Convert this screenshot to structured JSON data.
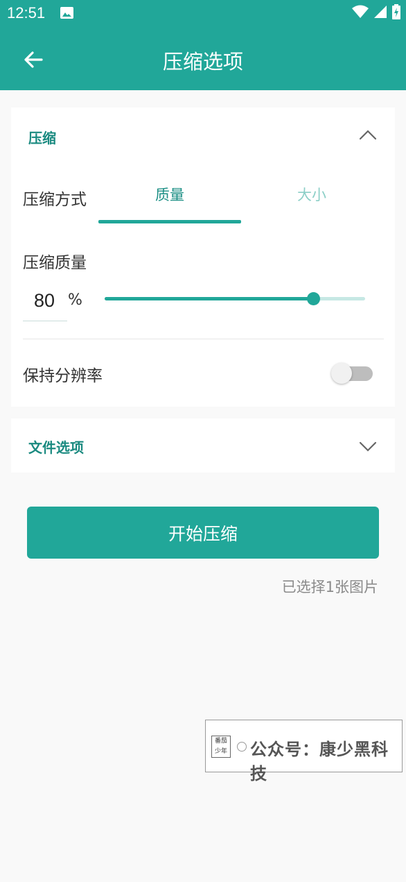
{
  "status_bar": {
    "time": "12:51",
    "icons": [
      "image-icon",
      "wifi-icon",
      "signal-icon",
      "battery-icon"
    ]
  },
  "app_bar": {
    "title": "压缩选项",
    "back_icon": "arrow-back-icon"
  },
  "compression_section": {
    "title": "压缩",
    "expanded": true,
    "mode_label": "压缩方式",
    "tabs": [
      {
        "label": "质量",
        "selected": true
      },
      {
        "label": "大小",
        "selected": false
      }
    ],
    "quality_label": "压缩质量",
    "quality_value": "80",
    "quality_unit": "%",
    "slider_level": 0.8,
    "keep_resolution_label": "保持分辨率",
    "keep_resolution_on": false
  },
  "file_section": {
    "title": "文件选项",
    "expanded": false
  },
  "start_button": "开始压缩",
  "selected_count": "已选择1张图片",
  "watermark": {
    "logo_text": "番茄 少年",
    "text": "公众号：康少黑科技"
  },
  "colors": {
    "primary": "#21a799",
    "primary_dark_text": "#1a8a80",
    "tab_inactive": "#8ccfc7",
    "background": "#f9f9f9"
  }
}
